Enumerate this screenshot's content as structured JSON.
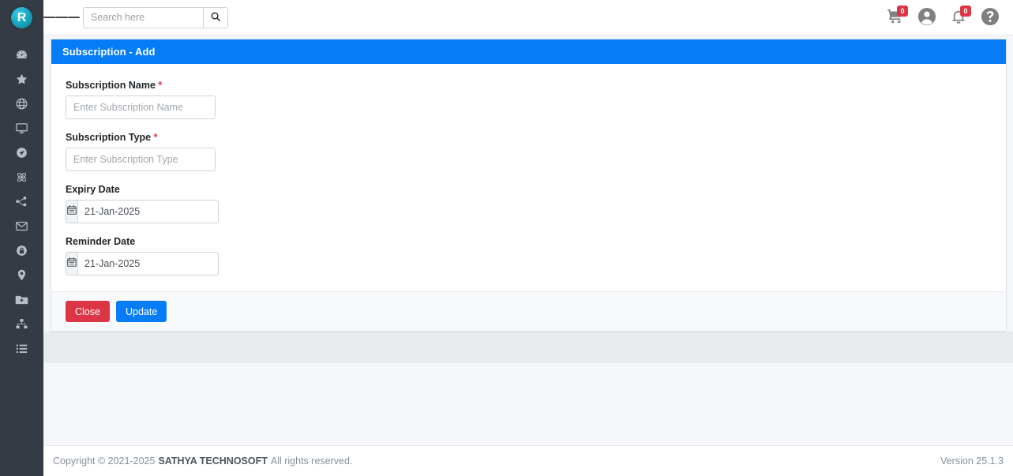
{
  "brand": {
    "logo_letter": "R",
    "logo_color": "#17a2bd"
  },
  "topbar": {
    "menu_icon": "hamburger-icon",
    "search": {
      "placeholder": "Search here",
      "value": "",
      "button_icon": "search-icon"
    },
    "cart": {
      "icon": "shopping-cart-icon",
      "badge": "0"
    },
    "account": {
      "icon": "user-circle-icon"
    },
    "notifications": {
      "icon": "bell-icon",
      "badge": "0"
    },
    "help": {
      "icon": "question-circle-icon"
    }
  },
  "sidebar": {
    "items": [
      {
        "icon": "dashboard-icon",
        "name": "dashboard"
      },
      {
        "icon": "star-icon",
        "name": "favorites"
      },
      {
        "icon": "globe-icon",
        "name": "global"
      },
      {
        "icon": "desktop-icon",
        "name": "desktop"
      },
      {
        "icon": "paper-plane-icon",
        "name": "send"
      },
      {
        "icon": "atom-icon",
        "name": "atom"
      },
      {
        "icon": "share-nodes-icon",
        "name": "share"
      },
      {
        "icon": "envelope-icon",
        "name": "mail"
      },
      {
        "icon": "lock-icon",
        "name": "security"
      },
      {
        "icon": "map-marker-icon",
        "name": "location"
      },
      {
        "icon": "folder-plus-icon",
        "name": "add-folder"
      },
      {
        "icon": "sitemap-icon",
        "name": "sitemap"
      },
      {
        "icon": "list-icon",
        "name": "list"
      }
    ]
  },
  "page": {
    "card_title": "Subscription - Add",
    "accent_color": "#067df7",
    "fields": [
      {
        "label": "Subscription Name",
        "required": true,
        "required_mark": "*",
        "placeholder": "Enter Subscription Name",
        "value": "",
        "type": "text"
      },
      {
        "label": "Subscription Type",
        "required": true,
        "required_mark": "*",
        "placeholder": "Enter Subscription Type",
        "value": "",
        "type": "text"
      },
      {
        "label": "Expiry Date",
        "required": false,
        "required_mark": "",
        "placeholder": "",
        "value": "21-Jan-2025",
        "type": "date",
        "icon": "calendar-icon"
      },
      {
        "label": "Reminder Date",
        "required": false,
        "required_mark": "",
        "placeholder": "",
        "value": "21-Jan-2025",
        "type": "date",
        "icon": "calendar-icon"
      }
    ],
    "buttons": {
      "close_label": "Close",
      "close_color": "#dc3545",
      "update_label": "Update",
      "update_color": "#067df7"
    }
  },
  "footer": {
    "copyright_prefix": "Copyright © 2021-2025",
    "company": "SATHYA TECHNOSOFT",
    "copyright_suffix": "All rights reserved.",
    "version": "Version 25.1.3"
  }
}
